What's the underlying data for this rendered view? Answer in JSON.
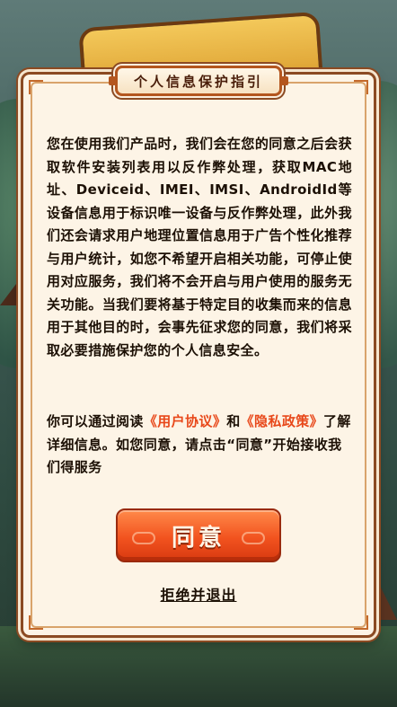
{
  "dialog": {
    "title": "个人信息保护指引",
    "paragraph1": "您在使用我们产品时，我们会在您的同意之后会获取软件安装列表用以反作弊处理，获取MAC地址、Deviceid、IMEI、IMSI、AndroidId等设备信息用于标识唯一设备与反作弊处理，此外我们还会请求用户地理位置信息用于广告个性化推荐与用户统计，如您不希望开启相关功能，可停止使用对应服务，我们将不会开启与用户使用的服务无关功能。当我们要将基于特定目的收集而来的信息用于其他目的时，会事先征求您的同意，我们将采取必要措施保护您的个人信息安全。",
    "paragraph2_prefix": "你可以通过阅读",
    "user_agreement_link": "《用户协议》",
    "paragraph2_and": "和",
    "privacy_policy_link": "《隐私政策》",
    "paragraph2_suffix": "了解详细信息。如您同意，请点击“同意”开始接收我们得服务",
    "agree_label": "同意",
    "reject_label": "拒绝并退出"
  },
  "colors": {
    "accent": "#f2531f",
    "link": "#e8481a",
    "border": "#8b4a22",
    "panel": "#fdf4e6"
  }
}
